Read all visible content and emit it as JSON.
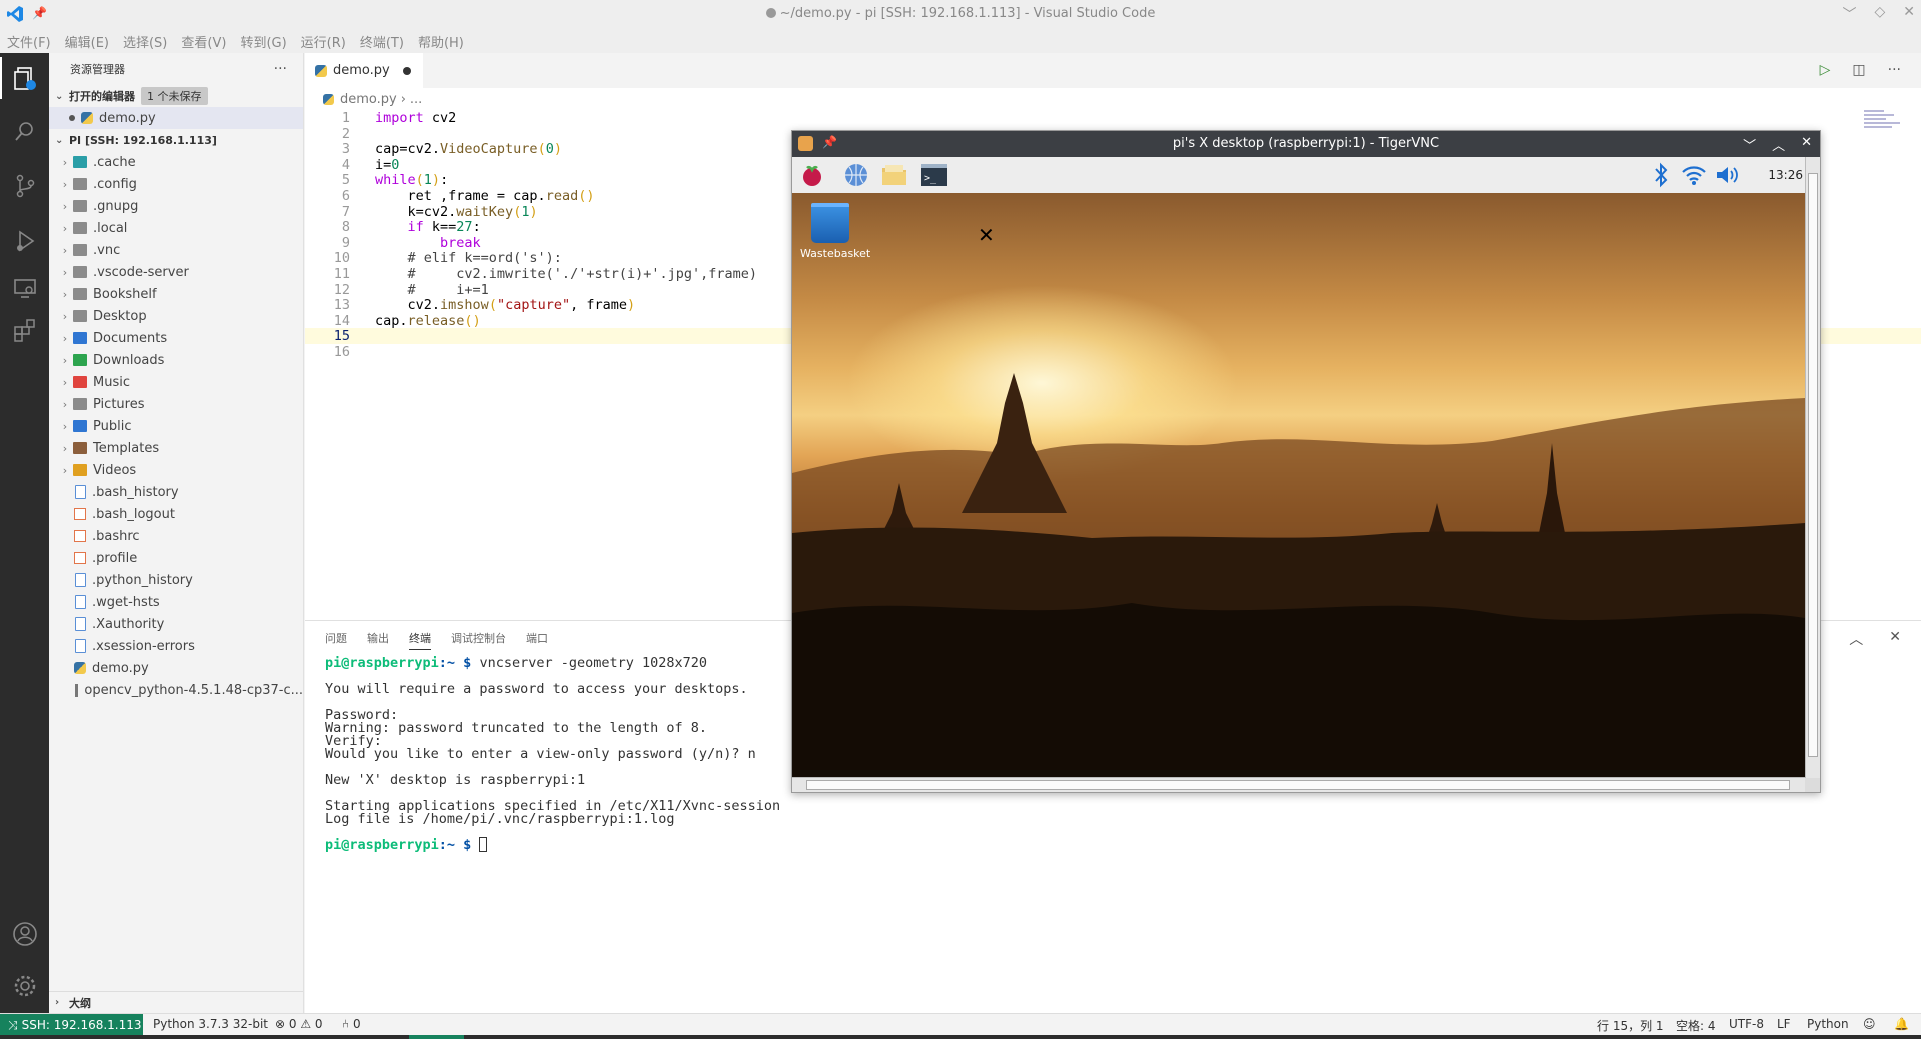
{
  "window": {
    "title": "~/demo.py - pi [SSH: 192.168.1.113] - Visual Studio Code",
    "controls": [
      "﹀",
      "◇",
      "✕"
    ]
  },
  "menu": [
    "文件(F)",
    "编辑(E)",
    "选择(S)",
    "查看(V)",
    "转到(G)",
    "运行(R)",
    "终端(T)",
    "帮助(H)"
  ],
  "explorer": {
    "title": "资源管理器",
    "more": "···",
    "open_editors": {
      "label": "打开的编辑器",
      "badge": "1 个未保存",
      "file": "demo.py"
    },
    "remote_root": "PI [SSH: 192.168.1.113]",
    "folders": [
      ".cache",
      ".config",
      ".gnupg",
      ".local",
      ".vnc",
      ".vscode-server",
      "Bookshelf",
      "Desktop",
      "Documents",
      "Downloads",
      "Music",
      "Pictures",
      "Public",
      "Templates",
      "Videos"
    ],
    "files": [
      ".bash_history",
      ".bash_logout",
      ".bashrc",
      ".profile",
      ".python_history",
      ".wget-hsts",
      ".Xauthority",
      ".xsession-errors",
      "demo.py",
      "opencv_python-4.5.1.48-cp37-c..."
    ],
    "outline": "大纲"
  },
  "folder_colors": {
    ".cache": "#2a9ea7",
    "Documents": "#2f76d2",
    "Downloads": "#2da44e",
    "Music": "#e0443e",
    "Public": "#2f76d2",
    "Templates": "#8b5e3c",
    "Videos": "#e0a020",
    "Desktop": "#8b8b8b"
  },
  "editor": {
    "tab": "demo.py",
    "breadcrumb": [
      "demo.py",
      "..."
    ],
    "current_line": 15,
    "lines": [
      {
        "n": "1",
        "t": "import cv2"
      },
      {
        "n": "2",
        "t": ""
      },
      {
        "n": "3",
        "t": "cap=cv2.VideoCapture(0)"
      },
      {
        "n": "4",
        "t": "i=0"
      },
      {
        "n": "5",
        "t": "while(1):"
      },
      {
        "n": "6",
        "t": "    ret ,frame = cap.read()"
      },
      {
        "n": "7",
        "t": "    k=cv2.waitKey(1)"
      },
      {
        "n": "8",
        "t": "    if k==27:"
      },
      {
        "n": "9",
        "t": "        break"
      },
      {
        "n": "10",
        "t": "    # elif k==ord('s'):"
      },
      {
        "n": "11",
        "t": "    #     cv2.imwrite('./'+str(i)+'.jpg',frame)"
      },
      {
        "n": "12",
        "t": "    #     i+=1"
      },
      {
        "n": "13",
        "t": "    cv2.imshow(\"capture\", frame)"
      },
      {
        "n": "14",
        "t": "cap.release()"
      },
      {
        "n": "15",
        "t": ""
      },
      {
        "n": "16",
        "t": ""
      }
    ]
  },
  "panel": {
    "tabs": [
      "问题",
      "输出",
      "终端",
      "调试控制台",
      "端口"
    ],
    "active_tab": "终端",
    "prompt_user": "pi@raspberrypi",
    "prompt_path": ":~ $",
    "command": " vncserver -geometry 1028x720",
    "output": [
      "You will require a password to access your desktops.",
      "",
      "Password:",
      "Warning: password truncated to the length of 8.",
      "Verify:",
      "Would you like to enter a view-only password (y/n)? n",
      "",
      "New 'X' desktop is raspberrypi:1",
      "",
      "Starting applications specified in /etc/X11/Xvnc-session",
      "Log file is /home/pi/.vnc/raspberrypi:1.log"
    ]
  },
  "status": {
    "remote": "SSH: 192.168.1.113",
    "python": "Python 3.7.3 32-bit",
    "problems": "⊗ 0 ⚠ 0",
    "ports": "⑃ 0",
    "position": "行 15，列 1",
    "spaces": "空格: 4",
    "encoding": "UTF-8",
    "eol": "LF",
    "language": "Python"
  },
  "vnc": {
    "title": "pi's X desktop (raspberrypi:1) - TigerVNC",
    "clock": "13:26",
    "desktop_icon": "Wastebasket"
  }
}
